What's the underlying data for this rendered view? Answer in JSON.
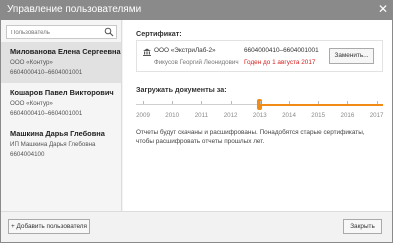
{
  "window": {
    "title": "Управление пользователями",
    "close_glyph": "✕"
  },
  "sidebar": {
    "search": {
      "placeholder": "Пользователь",
      "value": ""
    },
    "users": [
      {
        "name": "Милованова Елена Сергеевна",
        "org": "ООО «Контур»",
        "inn": "6604000410–6604001001",
        "selected": true
      },
      {
        "name": "Кошаров Павел Викторович",
        "org": "ООО «Контур»",
        "inn": "6604000410–6604001001",
        "selected": false
      },
      {
        "name": "Машкина Дарья Глебовна",
        "org": "ИП Машкина Дарья Глебовна",
        "inn": "6604004100",
        "selected": false
      }
    ]
  },
  "main": {
    "certificate_label": "Сертификат:",
    "certificate": {
      "org": "ООО «ЭкстриЛаб-2»",
      "inn": "6604000410–6604001001",
      "person": "Фикусов Георгий Леонидович",
      "validity": "Годен до 1 августа 2017",
      "change_button": "Заменить..."
    },
    "load_label": "Загружать документы за:",
    "years": [
      "2009",
      "2010",
      "2011",
      "2012",
      "2013",
      "2014",
      "2015",
      "2016",
      "2017"
    ],
    "selected_year": "2013",
    "note": "Отчеты будут скачаны и расшифрованы. Понадобятся старые сертификаты, чтобы расшифровать отчеты прошлых лет."
  },
  "footer": {
    "add_user_button": "+ Добавить пользователя",
    "close_button": "Закрыть"
  },
  "colors": {
    "accent": "#f08c16",
    "warning": "#d51f1f",
    "titlebar": "#8a8a8a"
  }
}
